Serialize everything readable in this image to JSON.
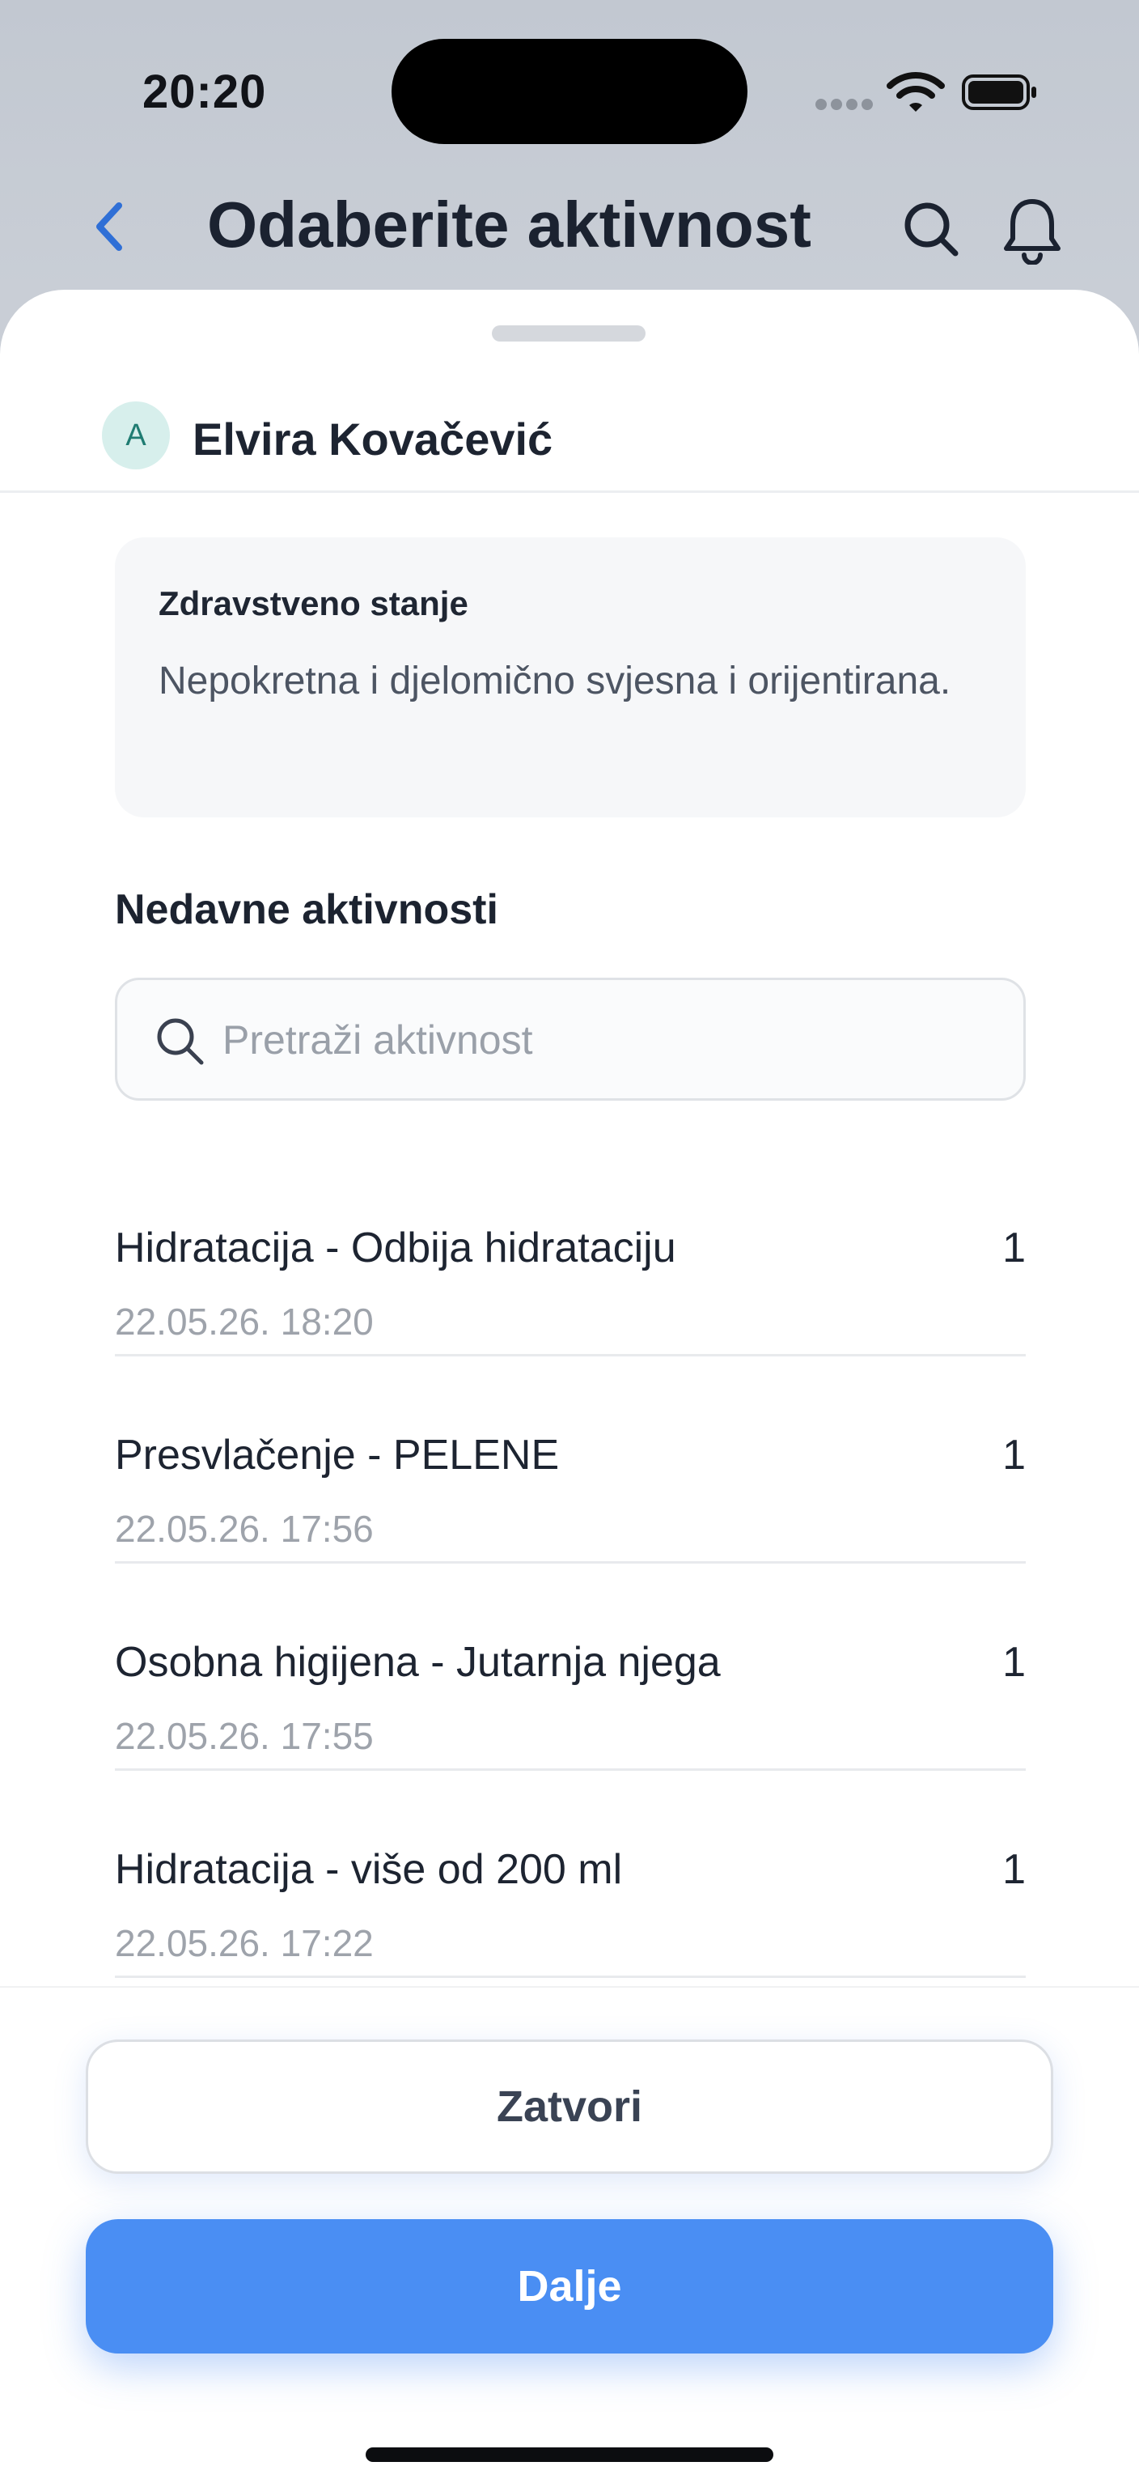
{
  "status_bar": {
    "time": "20:20"
  },
  "nav": {
    "title": "Odaberite aktivnost",
    "back_icon": "chevron-left-icon",
    "search_icon": "search-icon",
    "bell_icon": "bell-icon"
  },
  "patient": {
    "avatar_initial": "A",
    "name": "Elvira Kovačević"
  },
  "health": {
    "title": "Zdravstveno stanje",
    "text": "Nepokretna i djelomično svjesna i orijentirana."
  },
  "recent": {
    "title": "Nedavne aktivnosti",
    "search_placeholder": "Pretraži aktivnost",
    "search_value": "",
    "items": [
      {
        "name": "Hidratacija - Odbija hidrataciju",
        "date": "22.05.26. 18:20",
        "count": "1"
      },
      {
        "name": "Presvlačenje - PELENE",
        "date": "22.05.26. 17:56",
        "count": "1"
      },
      {
        "name": "Osobna higijena - Jutarnja njega",
        "date": "22.05.26. 17:55",
        "count": "1"
      },
      {
        "name": "Hidratacija - više od 200 ml",
        "date": "22.05.26. 17:22",
        "count": "1"
      }
    ]
  },
  "footer": {
    "close_label": "Zatvori",
    "next_label": "Dalje"
  },
  "colors": {
    "accent": "#4a8ef3",
    "back_chevron": "#2f6fd6",
    "avatar_bg": "#d7efec",
    "avatar_text": "#1f7c72"
  }
}
